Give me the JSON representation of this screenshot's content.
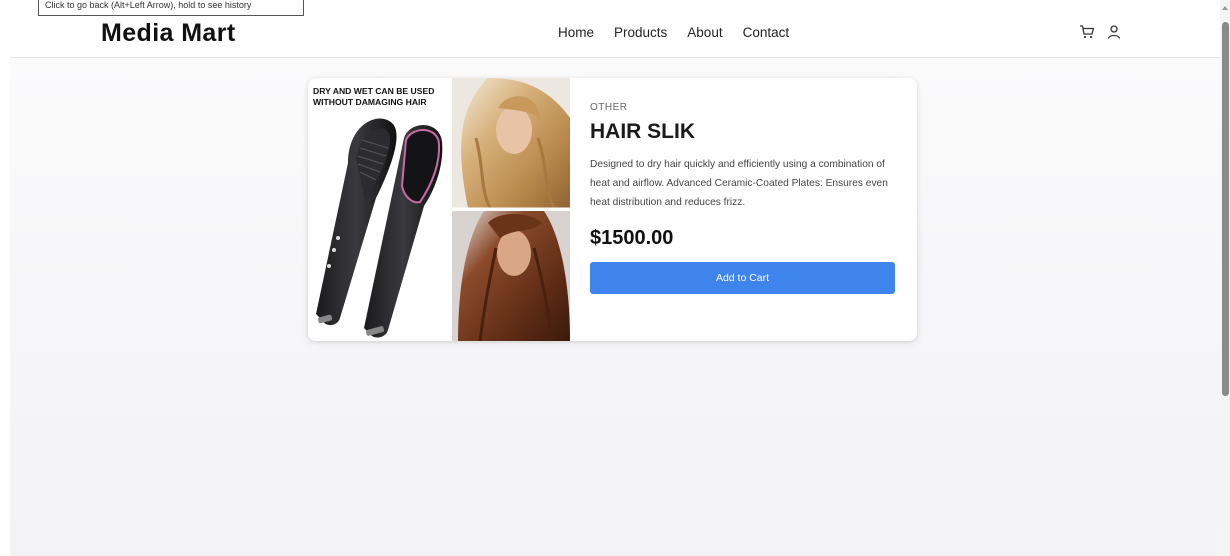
{
  "tooltip": {
    "text": "Click to go back (Alt+Left Arrow), hold to see history"
  },
  "header": {
    "brand": "Media Mart",
    "nav": [
      {
        "label": "Home"
      },
      {
        "label": "Products"
      },
      {
        "label": "About"
      },
      {
        "label": "Contact"
      }
    ],
    "icons": [
      "cart-icon",
      "user-icon"
    ]
  },
  "product": {
    "image_caption_line1": "DRY AND WET CAN BE USED",
    "image_caption_line2": "WITHOUT DAMAGING HAIR",
    "category": "OTHER",
    "title": "HAIR SLIK",
    "description": "Designed to dry hair quickly and efficiently using a combination of heat and airflow. Advanced Ceramic-Coated Plates: Ensures even heat distribution and reduces frizz.",
    "price": "$1500.00",
    "add_to_cart_label": "Add to Cart"
  },
  "colors": {
    "accent": "#3f83ed",
    "page_background": "#f5f5f7"
  }
}
